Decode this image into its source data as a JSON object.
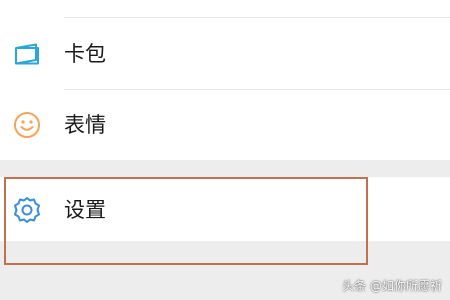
{
  "menu": {
    "items": [
      {
        "label": "卡包",
        "icon": "card-wallet-icon",
        "icon_color": "#2aa7d6"
      },
      {
        "label": "表情",
        "icon": "smiley-icon",
        "icon_color": "#f5a45a"
      },
      {
        "label": "设置",
        "icon": "gear-icon",
        "icon_color": "#3c8ed8"
      }
    ]
  },
  "annotation": {
    "highlight_color": "#c1714f"
  },
  "watermark": {
    "text": "头条 @如你所愿祈"
  }
}
